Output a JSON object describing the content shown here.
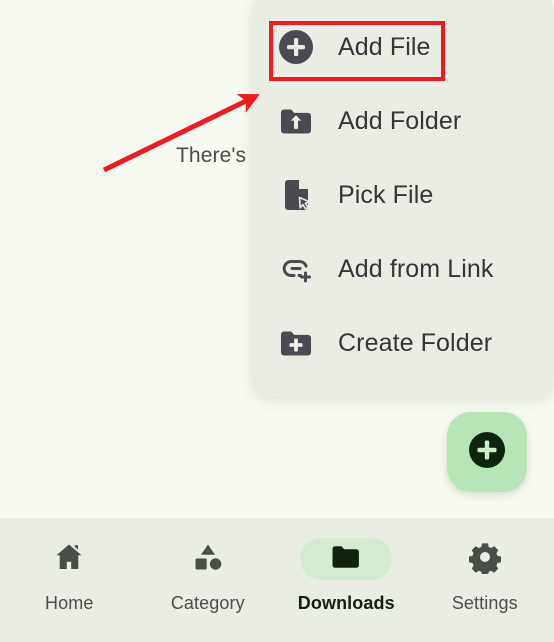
{
  "app": {
    "background_color": "#f7faf1",
    "surface_color": "#e9ede4",
    "accent_color": "#b6e6b7",
    "icon_color": "#4a4a52",
    "annotation_color": "#ee1c22"
  },
  "annotation": {
    "text": "There's",
    "arrow": "red-arrow-pointing-up-right",
    "highlight_target": "Add File"
  },
  "menu": {
    "items": [
      {
        "label": "Add File",
        "icon": "plus-circle-icon",
        "highlighted": true
      },
      {
        "label": "Add Folder",
        "icon": "folder-upload-icon",
        "highlighted": false
      },
      {
        "label": "Pick File",
        "icon": "file-cursor-icon",
        "highlighted": false
      },
      {
        "label": "Add from Link",
        "icon": "link-plus-icon",
        "highlighted": false
      },
      {
        "label": "Create Folder",
        "icon": "folder-plus-icon",
        "highlighted": false
      }
    ]
  },
  "fab": {
    "icon": "plus-icon",
    "label": "Add",
    "background_color": "#b6e6b7",
    "glyph_color": "#0f2410"
  },
  "bottom_nav": {
    "active_index": 2,
    "items": [
      {
        "label": "Home",
        "icon": "home-icon",
        "active": false
      },
      {
        "label": "Category",
        "icon": "shapes-icon",
        "active": false
      },
      {
        "label": "Downloads",
        "icon": "folder-icon",
        "active": true
      },
      {
        "label": "Settings",
        "icon": "gear-icon",
        "active": false
      }
    ]
  }
}
